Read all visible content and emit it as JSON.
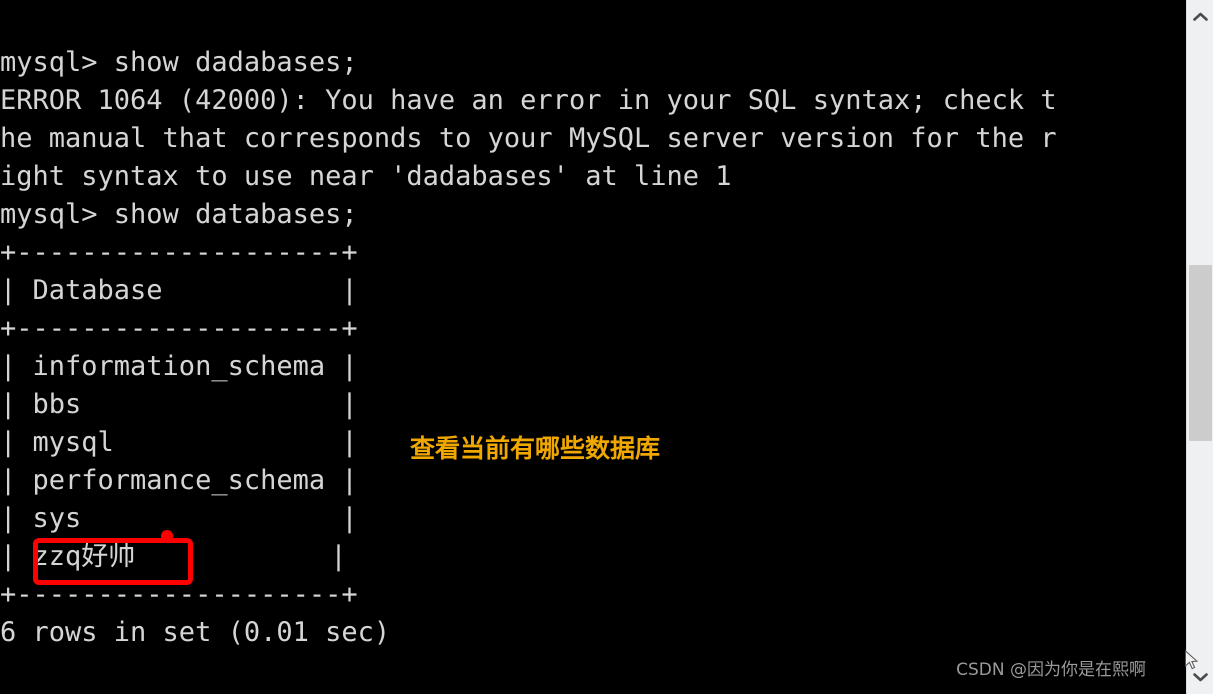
{
  "terminal": {
    "background_color": "#000000",
    "text_color": "#d5d5d5",
    "lines": [
      "mysql> show dadabases;",
      "ERROR 1064 (42000): You have an error in your SQL syntax; check t",
      "he manual that corresponds to your MySQL server version for the r",
      "ight syntax to use near 'dadabases' at line 1",
      "mysql> show databases;",
      "+--------------------+",
      "| Database           |",
      "+--------------------+",
      "| information_schema |",
      "| bbs                |",
      "| mysql              |",
      "| performance_schema |",
      "| sys                |",
      "| zzq好帅            |",
      "+--------------------+",
      "6 rows in set (0.01 sec)"
    ],
    "prompt": "mysql>",
    "commands": [
      "show dadabases;",
      "show databases;"
    ],
    "error": {
      "code": "ERROR 1064",
      "sqlstate": "(42000)",
      "message": "You have an error in your SQL syntax; check the manual that corresponds to your MySQL server version for the right syntax to use near 'dadabases' at line 1"
    },
    "result_table": {
      "column_header": "Database",
      "rows": [
        "information_schema",
        "bbs",
        "mysql",
        "performance_schema",
        "sys",
        "zzq好帅"
      ],
      "separator": "+--------------------+",
      "status_line": "6 rows in set (0.01 sec)",
      "row_count": "6",
      "duration": "0.01 sec"
    }
  },
  "annotations": {
    "note_text": "查看当前有哪些数据库",
    "note_color": "#f0a800",
    "highlight_color": "#fe0000",
    "highlighted_value": "zzq好帅"
  },
  "watermark": {
    "text": "CSDN @因为你是在熙啊",
    "color": "#9a9a9a"
  },
  "scrollbar": {
    "track_color": "#eff0f1",
    "thumb_color": "#cccccc",
    "up_arrow": "chevron-up-icon",
    "down_arrow": "chevron-down-icon"
  }
}
